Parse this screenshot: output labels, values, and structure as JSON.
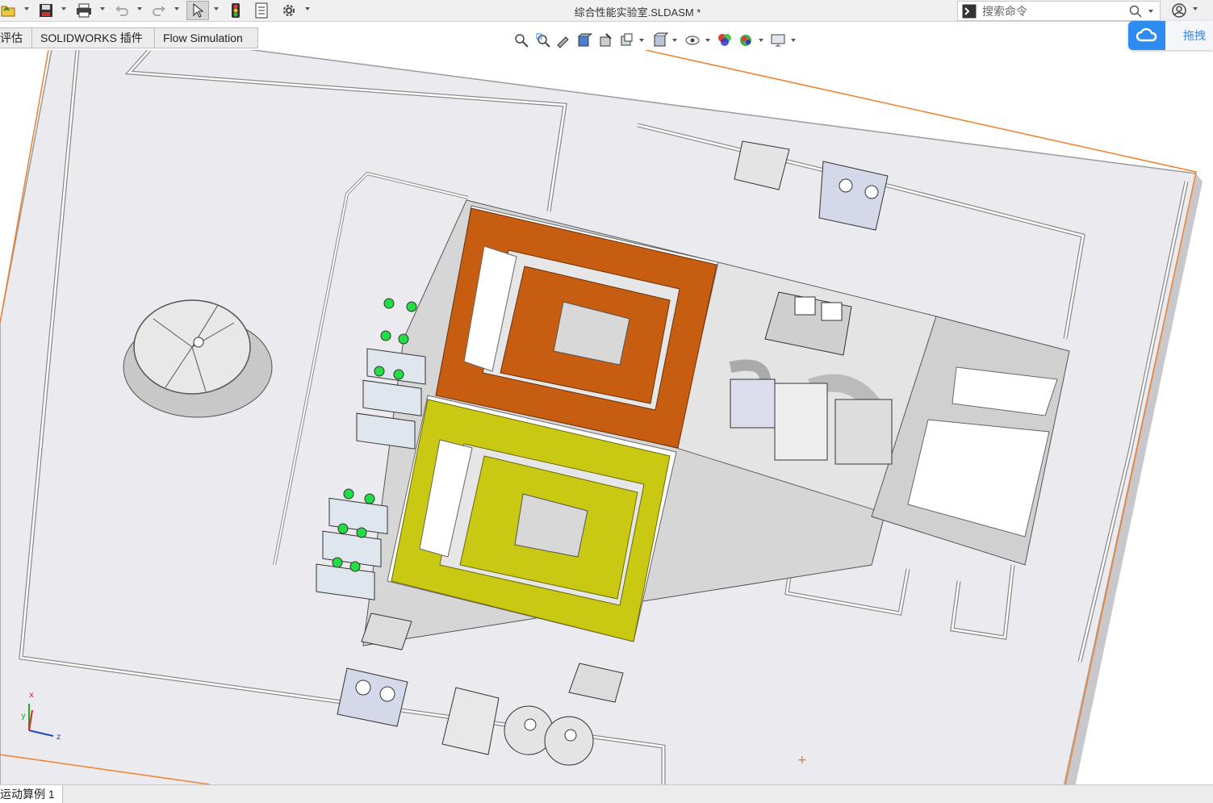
{
  "window": {
    "title": "综合性能实验室.SLDASM *"
  },
  "search": {
    "placeholder": "搜索命令"
  },
  "tabs": [
    {
      "label": "评估"
    },
    {
      "label": "SOLIDWORKS 插件"
    },
    {
      "label": "Flow Simulation"
    }
  ],
  "cloud_widget": {
    "label": "拖拽"
  },
  "status_tabs": [
    {
      "label": "运动算例 1"
    }
  ],
  "triad": {
    "x": "x",
    "y": "y",
    "z": "z"
  },
  "colors": {
    "accent": "#2e8cf0",
    "orange_room": "#c65d10",
    "yellow_room": "#c9c812",
    "boundary_orange": "#f08030"
  }
}
